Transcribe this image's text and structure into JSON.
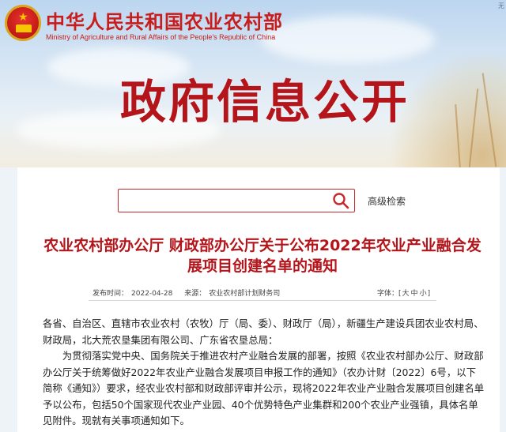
{
  "header": {
    "ministry_cn": "中华人民共和国农业农村部",
    "ministry_en": "Ministry of Agriculture and Rural Affairs of the People's Republic of China",
    "corner": "无",
    "section_title": "政府信息公开"
  },
  "search": {
    "placeholder": "",
    "advanced_label": "高级检索"
  },
  "article": {
    "title": "农业农村部办公厅 财政部办公厅关于公布2022年农业产业融合发展项目创建名单的通知",
    "publish_label": "发布时间：",
    "publish_date": "2022-04-28",
    "source_label": "来源：",
    "source": "农业农村部计划财务司",
    "font_label": "字体：",
    "font_open": "[",
    "font_large": "大",
    "font_medium": "中",
    "font_small": "小",
    "font_close": "]",
    "paragraphs": [
      "各省、自治区、直辖市农业农村（农牧）厅（局、委）、财政厅（局），新疆生产建设兵团农业农村局、财政局，北大荒农垦集团有限公司、广东省农垦总局：",
      "为贯彻落实党中央、国务院关于推进农村产业融合发展的部署，按照《农业农村部办公厅、财政部办公厅关于统筹做好2022年农业产业融合发展项目申报工作的通知》（农办计财〔2022〕6号，以下简称《通知》）要求，经农业农村部和财政部评审并公示，现将2022年农业产业融合发展项目创建名单予以公布，包括50个国家现代农业产业园、40个优势特色产业集群和200个农业产业强镇，具体名单见附件。现就有关事项通知如下。"
    ]
  },
  "colors": {
    "brand_red": "#b4151b",
    "search_border": "#c6282b"
  }
}
